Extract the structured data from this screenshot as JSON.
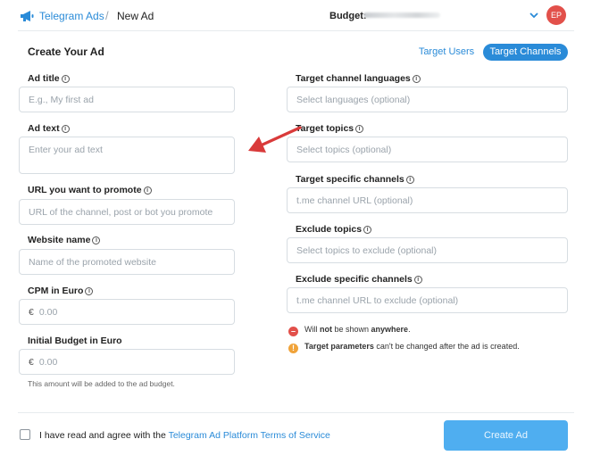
{
  "header": {
    "brand": "Telegram Ads",
    "separator": "/",
    "page": "New Ad",
    "budget_label": "Budget:",
    "avatar_initials": "EP"
  },
  "form": {
    "title": "Create Your Ad",
    "target_users_label": "Target Users",
    "target_channels_label": "Target Channels",
    "left_fields": [
      {
        "label": "Ad title",
        "placeholder": "E.g., My first ad"
      },
      {
        "label": "Ad text",
        "placeholder": "Enter your ad text"
      },
      {
        "label": "URL you want to promote",
        "placeholder": "URL of the channel, post or bot you promote"
      },
      {
        "label": "Website name",
        "placeholder": "Name of the promoted website"
      },
      {
        "label": "CPM in Euro",
        "prefix": "€",
        "placeholder": "0.00"
      },
      {
        "label": "Initial Budget in Euro",
        "prefix": "€",
        "placeholder": "0.00"
      }
    ],
    "budget_hint": "This amount will be added to the ad budget.",
    "right_fields": [
      {
        "label": "Target channel languages",
        "placeholder": "Select languages (optional)"
      },
      {
        "label": "Target topics",
        "placeholder": "Select topics (optional)"
      },
      {
        "label": "Target specific channels",
        "placeholder": "t.me channel URL (optional)"
      },
      {
        "label": "Exclude topics",
        "placeholder": "Select topics to exclude (optional)"
      },
      {
        "label": "Exclude specific channels",
        "placeholder": "t.me channel URL to exclude (optional)"
      }
    ],
    "notes": {
      "not_shown_pre": "Will ",
      "not_shown_bold1": "not",
      "not_shown_mid": " be shown ",
      "not_shown_bold2": "anywhere",
      "not_shown_post": ".",
      "params_bold": "Target parameters",
      "params_rest": " can't be changed after the ad is created."
    }
  },
  "footer": {
    "agree_text": "I have read and agree with the ",
    "terms_link": "Telegram Ad Platform Terms of Service",
    "create_button": "Create Ad"
  },
  "colors": {
    "accent": "#2a8bd8",
    "create_button": "#4faef0",
    "avatar": "#e2504a",
    "annotation_arrow": "#d93a3a"
  }
}
